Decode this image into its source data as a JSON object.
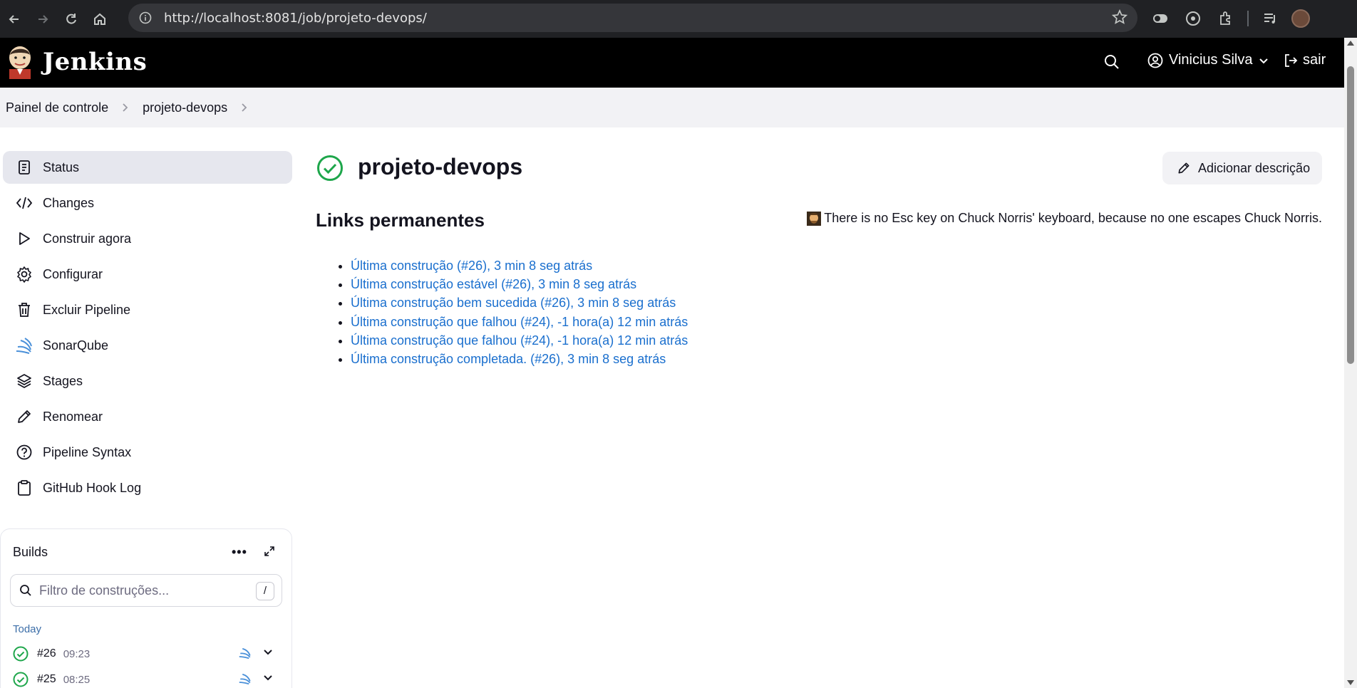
{
  "browser": {
    "url": "http://localhost:8081/job/projeto-devops/"
  },
  "header": {
    "brand": "Jenkins",
    "user_name": "Vinicius Silva",
    "logout_label": "sair"
  },
  "breadcrumb": {
    "items": [
      "Painel de controle",
      "projeto-devops"
    ]
  },
  "sidebar": {
    "items": [
      {
        "label": "Status",
        "icon": "document-icon"
      },
      {
        "label": "Changes",
        "icon": "code-icon"
      },
      {
        "label": "Construir agora",
        "icon": "play-icon"
      },
      {
        "label": "Configurar",
        "icon": "gear-icon"
      },
      {
        "label": "Excluir Pipeline",
        "icon": "trash-icon"
      },
      {
        "label": "SonarQube",
        "icon": "sonarqube-icon"
      },
      {
        "label": "Stages",
        "icon": "layers-icon"
      },
      {
        "label": "Renomear",
        "icon": "pencil-icon"
      },
      {
        "label": "Pipeline Syntax",
        "icon": "help-icon"
      },
      {
        "label": "GitHub Hook Log",
        "icon": "clipboard-icon"
      }
    ]
  },
  "builds": {
    "title": "Builds",
    "more_label": "•••",
    "filter_placeholder": "Filtro de construções...",
    "filter_shortcut": "/",
    "group_label": "Today",
    "rows": [
      {
        "number": "#26",
        "time": "09:23"
      },
      {
        "number": "#25",
        "time": "08:25"
      }
    ]
  },
  "main": {
    "title": "projeto-devops",
    "add_description_label": "Adicionar descrição",
    "permalinks_title": "Links permanentes",
    "chuck_quote": "There is no Esc key on Chuck Norris' keyboard, because no one escapes Chuck Norris.",
    "permalinks": [
      "Última construção (#26), 3 min 8 seg atrás",
      "Última construção estável (#26), 3 min 8 seg atrás",
      "Última construção bem sucedida (#26), 3 min 8 seg atrás",
      "Última construção que falhou (#24), -1 hora(a) 12 min atrás",
      "Última construção que falhou (#24), -1 hora(a) 12 min atrás",
      "Última construção completada. (#26), 3 min 8 seg atrás"
    ]
  },
  "colors": {
    "success": "#1ea64b",
    "link": "#1a6fce",
    "header_bg": "#000000",
    "breadcrumb_bg": "#f2f2f5",
    "active_item_bg": "#e6e7ee"
  }
}
